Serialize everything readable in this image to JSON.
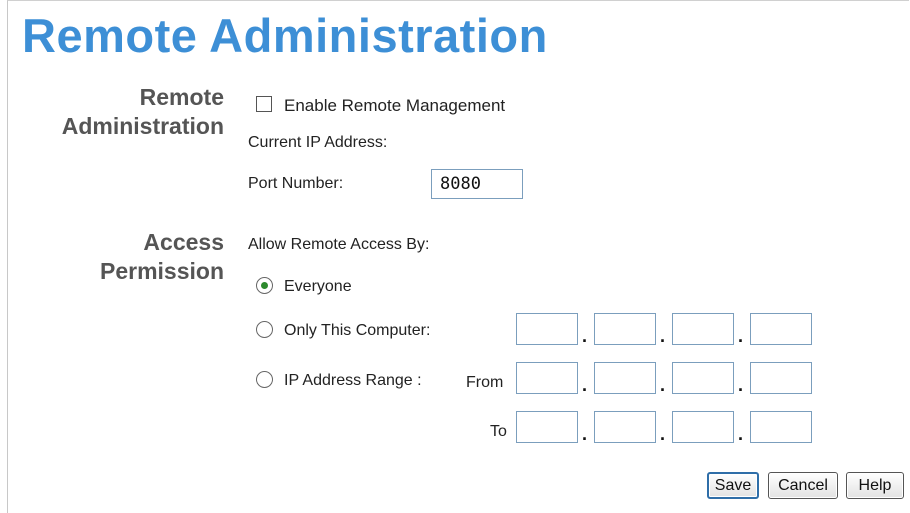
{
  "page": {
    "title": "Remote Administration"
  },
  "remote_admin": {
    "label_line1": "Remote",
    "label_line2": "Administration",
    "enable_label": "Enable Remote Management",
    "enable_checked": false,
    "current_ip_label": "Current IP Address:",
    "port_label": "Port Number:",
    "port_value": "8080"
  },
  "access": {
    "label_line1": "Access",
    "label_line2": "Permission",
    "allow_label": "Allow Remote Access By:",
    "everyone_label": "Everyone",
    "only_this_label": "Only This Computer:",
    "range_label": "IP Address Range :",
    "from_label": "From",
    "to_label": "To",
    "selected": "Everyone"
  },
  "buttons": {
    "save": "Save",
    "cancel": "Cancel",
    "help": "Help"
  },
  "colors": {
    "title": "#3d8fd6",
    "radio_selected": "#2d8a2d",
    "input_border": "#7b9ebd"
  }
}
